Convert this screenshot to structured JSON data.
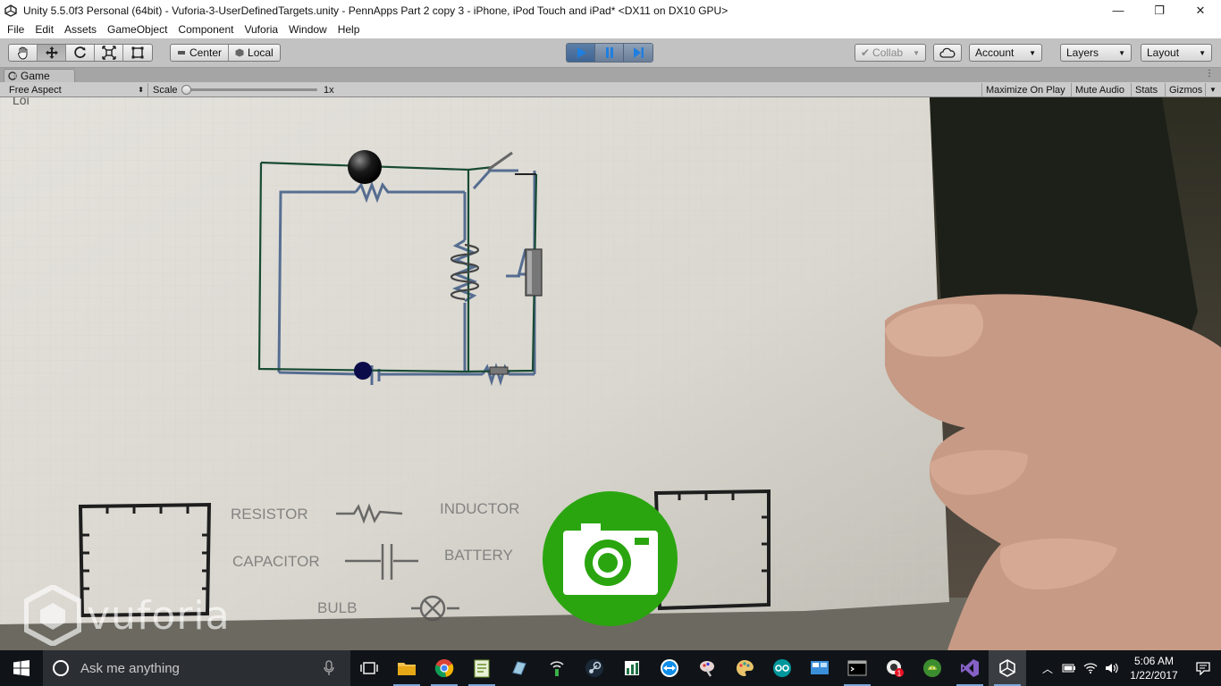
{
  "window": {
    "title": "Unity 5.5.0f3 Personal (64bit) - Vuforia-3-UserDefinedTargets.unity - PennApps Part 2 copy 3 - iPhone, iPod Touch and iPad* <DX11 on DX10 GPU>",
    "minimize": "—",
    "maximize": "❐",
    "close": "✕"
  },
  "menu": [
    "File",
    "Edit",
    "Assets",
    "GameObject",
    "Component",
    "Vuforia",
    "Window",
    "Help"
  ],
  "toolbar": {
    "tools": [
      "hand-icon",
      "move-icon",
      "rotate-icon",
      "scale-icon",
      "rect-icon"
    ],
    "active_tool": "move-icon",
    "pivot_label": "Center",
    "space_label": "Local",
    "collab_label": "Collab",
    "account_label": "Account",
    "layers_label": "Layers",
    "layout_label": "Layout",
    "playing": true
  },
  "game_panel": {
    "tab_label": "Game",
    "aspect_label": "Free Aspect",
    "scale_label": "Scale",
    "scale_value": "1x",
    "scale_fraction": 0.0,
    "toggles": [
      "Maximize On Play",
      "Mute Audio",
      "Stats",
      "Gizmos"
    ]
  },
  "scene": {
    "legend": {
      "resistor": "RESISTOR",
      "inductor": "INDUCTOR",
      "capacitor": "CAPACITOR",
      "battery": "BATTERY",
      "bulb": "BULB"
    },
    "watermark": "vuforia",
    "camera_button": "camera-icon"
  },
  "taskbar": {
    "search_placeholder": "Ask me anything",
    "apps": [
      "task-view-icon",
      "file-explorer-icon",
      "chrome-icon",
      "notepad-icon",
      "app-icon",
      "network-icon",
      "steam-icon",
      "spreadsheet-icon",
      "teamviewer-icon",
      "paint-icon",
      "palette-icon",
      "arduino-icon",
      "control-panel-icon",
      "terminal-icon",
      "badge-app-icon",
      "android-icon",
      "visual-studio-icon",
      "unity-icon"
    ],
    "badge_count": "1",
    "time": "5:06 AM",
    "date": "1/22/2017"
  },
  "colors": {
    "camera_green": "#2aa50f",
    "play_blue": "#1f7fe0",
    "taskbar": "#101418"
  }
}
